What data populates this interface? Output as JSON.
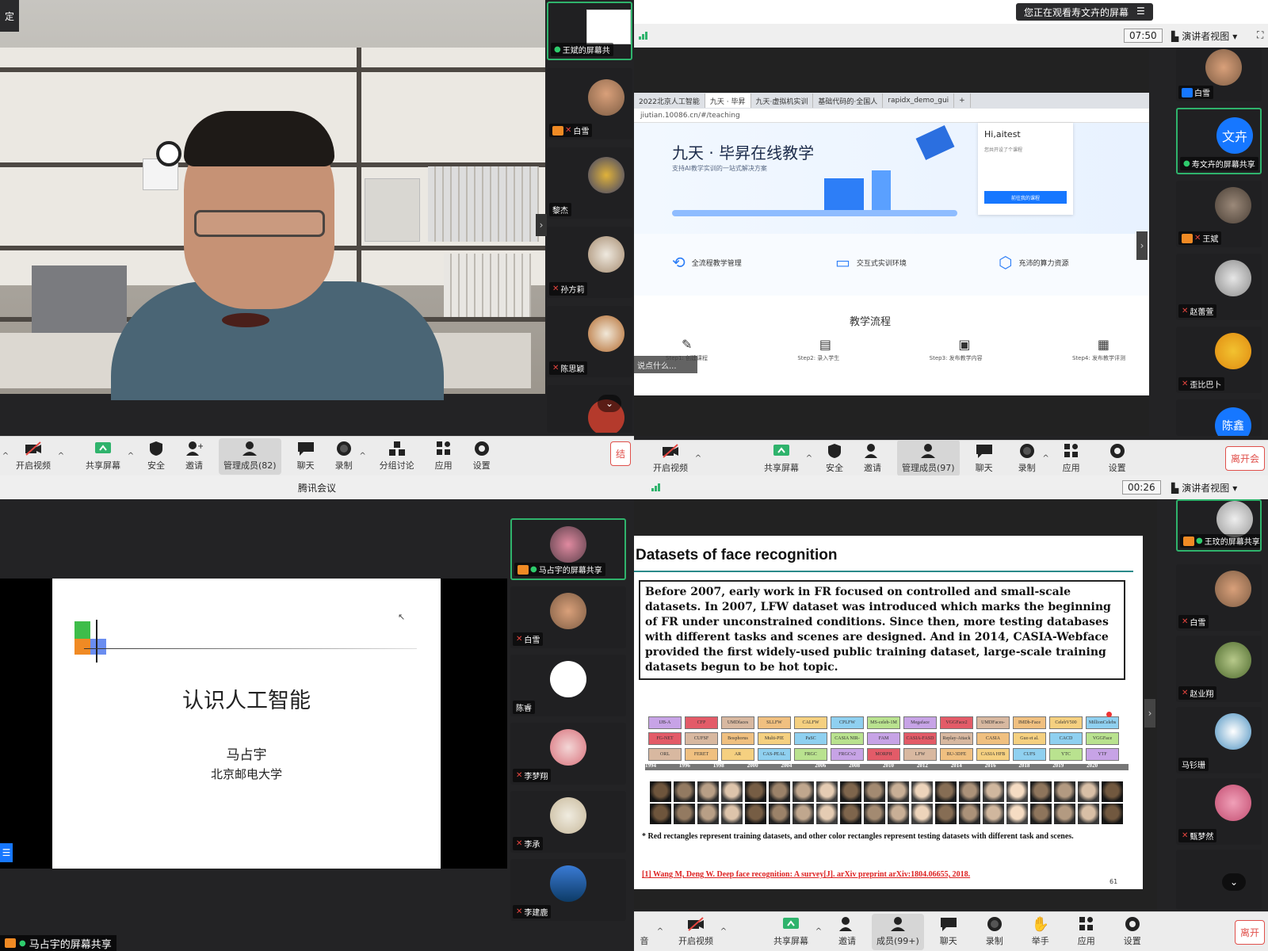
{
  "q1": {
    "top_left_label": "定",
    "self_share_name": "王斌的屏幕共",
    "participants": [
      {
        "name": "白雪"
      },
      {
        "name": "黎杰"
      },
      {
        "name": "孙方莉"
      },
      {
        "name": "陈思颖"
      }
    ],
    "toolbar": {
      "video": "开启视频",
      "share": "共享屏幕",
      "security": "安全",
      "invite": "邀请",
      "members": "管理成员(82)",
      "chat": "聊天",
      "record": "录制",
      "breakout": "分组讨论",
      "apps": "应用",
      "settings": "设置",
      "leave": "结"
    }
  },
  "q2": {
    "banner": "您正在观看寿文卉的屏幕",
    "timer": "07:50",
    "view": "演讲者视图",
    "browser": {
      "tabs": [
        "2022北京人工智能",
        "九天 · 毕昇",
        "九天·虚拟机实训",
        "基础代码的·全国人",
        "rapidx_demo_gui"
      ],
      "url": "jiutian.10086.cn/#/teaching",
      "hero_title": "九天 · 毕昇在线教学",
      "hero_sub": "支持AI教学实训的一站式解决方案",
      "hi_card": "Hi,aitest",
      "hi_line": "您共开设了个课程",
      "hi_btn": "前往我的课程",
      "features": [
        "全流程教学管理",
        "交互式实训环境",
        "充沛的算力资源"
      ],
      "flow_title": "教学流程",
      "steps": [
        "Step1: 创建课程",
        "Step2: 录入学生",
        "Step3: 发布教学内容",
        "Step4: 发布教学评测"
      ],
      "chat_hint": "说点什么..."
    },
    "participants": [
      {
        "name": "白雪"
      },
      {
        "name": "寿文卉的屏幕共享",
        "avatar_text": "文卉"
      },
      {
        "name": "王斌"
      },
      {
        "name": "赵蕾萱"
      },
      {
        "name": "歪比巴卜"
      },
      {
        "name": "陈鑫",
        "avatar_text": "陈鑫"
      }
    ],
    "toolbar": {
      "video": "开启视频",
      "share": "共享屏幕",
      "security": "安全",
      "invite": "邀请",
      "members": "管理成员(97)",
      "chat": "聊天",
      "record": "录制",
      "apps": "应用",
      "settings": "设置",
      "leave": "离开会"
    }
  },
  "q3": {
    "window_title": "腾讯会议",
    "slide_title": "认识人工智能",
    "slide_author": "马占宇",
    "slide_org": "北京邮电大学",
    "share_label": "马占宇的屏幕共享",
    "participants": [
      {
        "name": "马占宇的屏幕共享"
      },
      {
        "name": "白雪"
      },
      {
        "name": "陈睿"
      },
      {
        "name": "李梦翔"
      },
      {
        "name": "李承"
      },
      {
        "name": "李建鹿"
      }
    ]
  },
  "q4": {
    "timer": "00:26",
    "view": "演讲者视图",
    "slide": {
      "title": "Datasets of face recognition",
      "paragraph": "Before 2007, early work in FR focused on controlled and small-scale datasets. In 2007, LFW dataset was introduced which marks the beginning of FR under unconstrained conditions. Since then, more testing databases with different tasks and scenes are designed. And in 2014, CASIA-Webface provided the first widely-used public training dataset, large-scale training datasets begun to be hot topic.",
      "years": [
        "1994",
        "1996",
        "1998",
        "2000",
        "2004",
        "2006",
        "2008",
        "2010",
        "2012",
        "2014",
        "2016",
        "2018",
        "2019",
        "2020"
      ],
      "datasets": [
        "ORL",
        "FERET",
        "AR",
        "CAS-PEAL",
        "FRGC",
        "FRGCv2",
        "MORPH",
        "LFW",
        "BU-3DFE",
        "CASIA HFB",
        "CUFS",
        "YTC",
        "YTF",
        "FG-NET",
        "CUFSF",
        "Bosphorus",
        "Multi-PIE",
        "PaSC",
        "CASIA NIR-VIS v2.0",
        "FAM",
        "CASIA-FASD",
        "Replay-Attack",
        "CASIA WebFace",
        "Guo et al.",
        "CACD",
        "VGGFace",
        "IJB-A",
        "CFP",
        "UMDfaces",
        "SLLFW",
        "CALFW",
        "CPLFW",
        "MS-celeb-1M",
        "Megaface",
        "VGGFace2",
        "UMDFaces-Videos",
        "IMDb-Face",
        "CelebV500",
        "MillionCelebs"
      ],
      "note": "* Red rectangles represent training datasets, and other color rectangles represent testing datasets with different task and scenes.",
      "ref": "[1] Wang M, Deng W. Deep face recognition: A survey[J]. arXiv preprint arXiv:1804.06655, 2018.",
      "page": "61"
    },
    "participants": [
      {
        "name": "王玟的屏幕共享"
      },
      {
        "name": "白雪"
      },
      {
        "name": "赵业翔"
      },
      {
        "name": "马钐珊"
      },
      {
        "name": "甄梦然"
      }
    ],
    "toolbar": {
      "audio": "音",
      "video": "开启视频",
      "share": "共享屏幕",
      "invite": "邀请",
      "members": "成员(99+)",
      "chat": "聊天",
      "record": "录制",
      "raise": "举手",
      "apps": "应用",
      "settings": "设置",
      "leave": "离开"
    }
  }
}
